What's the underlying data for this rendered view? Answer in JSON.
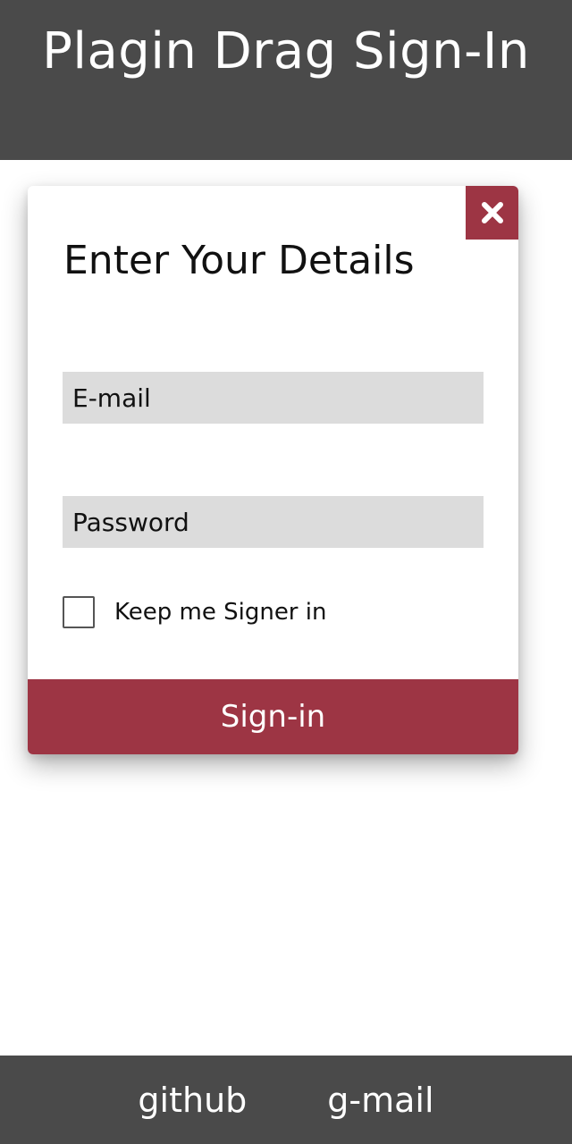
{
  "header": {
    "title": "Plagin Drag Sign-In"
  },
  "card": {
    "heading": "Enter Your Details",
    "close_icon": "close-x-icon",
    "email_placeholder": "E-mail",
    "password_placeholder": "Password",
    "remember_label": "Keep me Signer in",
    "remember_checked": false,
    "signin_label": "Sign-in"
  },
  "footer": {
    "links": [
      {
        "label": "github"
      },
      {
        "label": "g-mail"
      }
    ]
  },
  "colors": {
    "header_bg": "#4a4a4a",
    "accent": "#9d3544",
    "input_bg": "#dcdcdc"
  }
}
